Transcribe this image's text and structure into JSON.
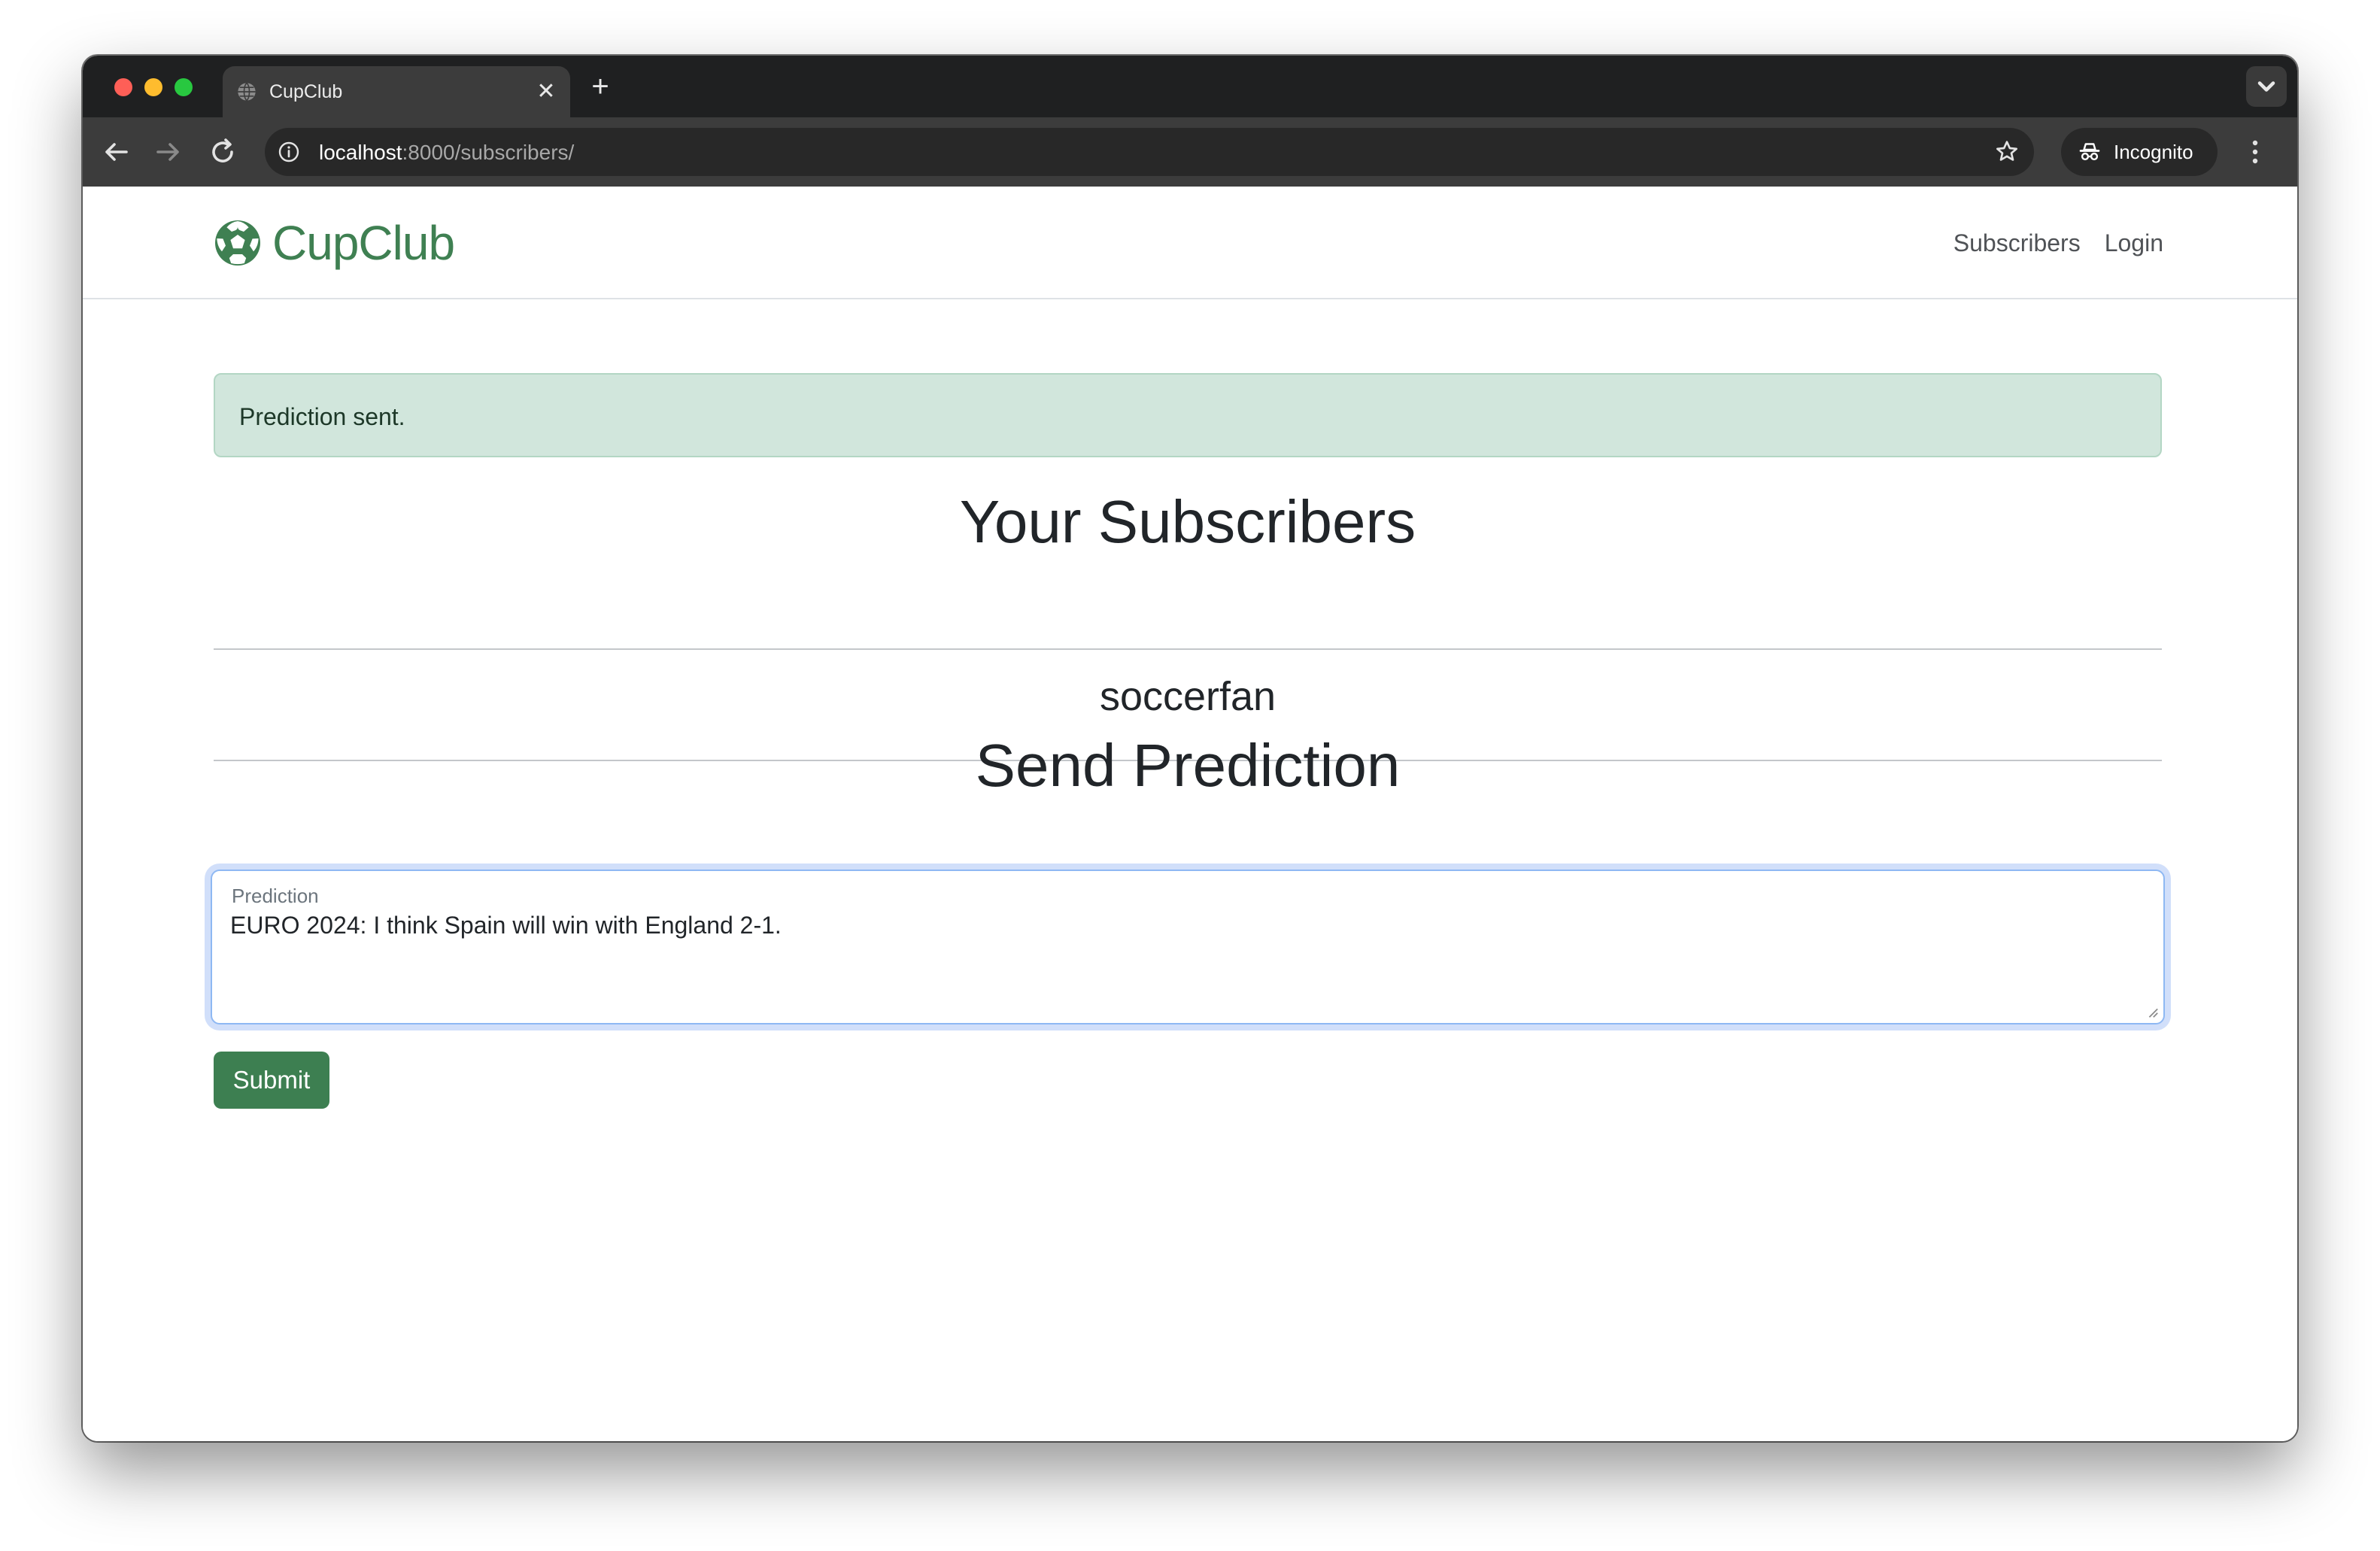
{
  "browser": {
    "tab_title": "CupClub",
    "tab_close_glyph": "✕",
    "new_tab_glyph": "+",
    "url_host": "localhost",
    "url_path": ":8000/subscribers/",
    "incognito_label": "Incognito",
    "icons": [
      "globe-icon",
      "back-arrow-icon",
      "forward-arrow-icon",
      "reload-icon",
      "info-icon",
      "star-icon",
      "incognito-icon",
      "kebab-menu-icon",
      "chevron-down-icon"
    ]
  },
  "site": {
    "brand": "CupClub",
    "brand_icon": "soccer-ball-icon",
    "brand_color": "#3f8052",
    "nav": [
      {
        "label": "Subscribers"
      },
      {
        "label": "Login"
      }
    ]
  },
  "alert": {
    "message": "Prediction sent.",
    "color": "#d1e6dc"
  },
  "subscribers": {
    "heading": "Your Subscribers",
    "items": [
      "soccerfan"
    ]
  },
  "prediction_form": {
    "heading": "Send Prediction",
    "field_label": "Prediction",
    "field_value": "EURO 2024: I think Spain will win with England 2-1.",
    "submit_label": "Submit",
    "submit_color": "#3d7f51"
  }
}
